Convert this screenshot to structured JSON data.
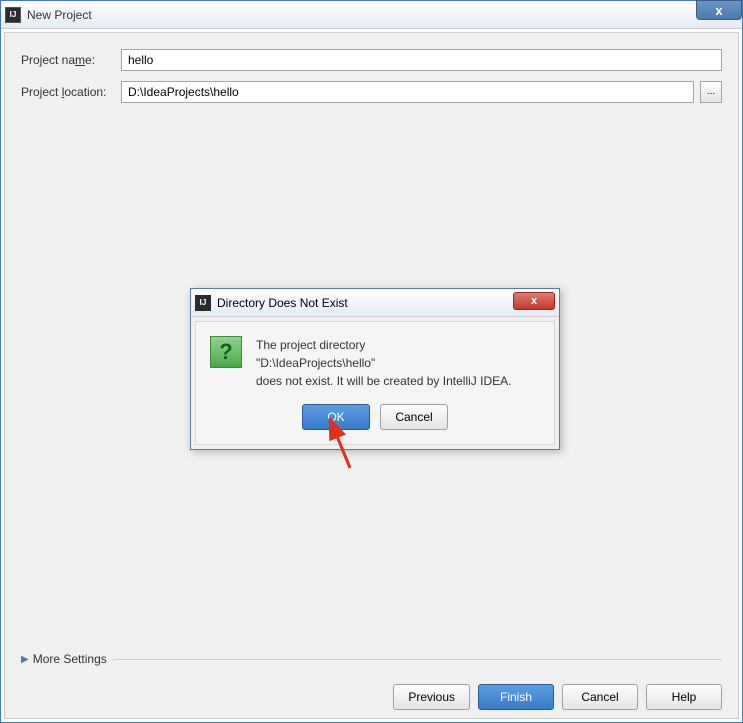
{
  "window": {
    "title": "New Project",
    "close_label": "x"
  },
  "form": {
    "project_name_label": "Project name:",
    "project_name_value": "hello",
    "project_location_label": "Project location:",
    "project_location_value": "D:\\IdeaProjects\\hello",
    "browse_label": "..."
  },
  "more_settings_label": "More Settings",
  "footer": {
    "previous": "Previous",
    "finish": "Finish",
    "cancel": "Cancel",
    "help": "Help"
  },
  "modal": {
    "title": "Directory Does Not Exist",
    "close_label": "x",
    "message_line1": "The project directory",
    "message_line2": "\"D:\\IdeaProjects\\hello\"",
    "message_line3": "does not exist. It will be created by IntelliJ IDEA.",
    "ok": "OK",
    "cancel": "Cancel"
  }
}
